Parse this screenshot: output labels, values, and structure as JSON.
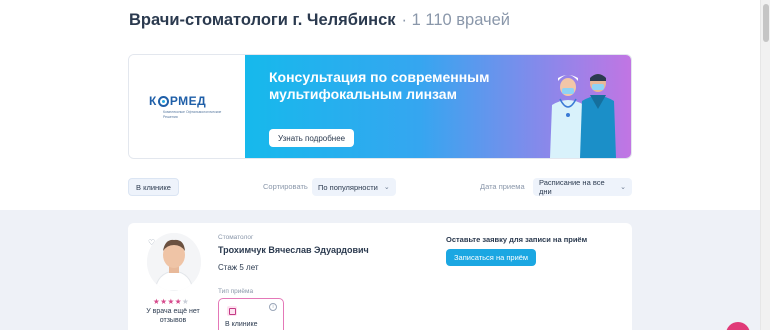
{
  "heading": {
    "title": "Врачи-стоматологи г. Челябинск",
    "count": "· 1 110 врачей"
  },
  "banner": {
    "logo_text": "КОРМЕД",
    "logo_subtitle": "Комплексные Офтальмологические Решения",
    "headline": "Консультация по современным мультифокальным линзам",
    "button_label": "Узнать подробнее"
  },
  "filters": {
    "chip_label": "В клинике",
    "sort_label": "Сортировать",
    "sort_value": "По популярности",
    "date_label": "Дата приема",
    "date_value": "Расписание на все дни"
  },
  "doctor": {
    "specialty": "Стоматолог",
    "name": "Трохимчук Вячеслав Эдуардович",
    "experience": "Стаж 5 лет",
    "rating": 4,
    "rating_max": 5,
    "reviews_text": "У врача ещё нет отзывов",
    "reception_type_label": "Тип приёма",
    "reception_type_value": "В клинике",
    "cta_title": "Оставьте заявку для записи на приём",
    "cta_button": "Записаться на приём"
  },
  "colors": {
    "accent": "#1ba7e2",
    "pink": "#e478b8",
    "star": "#d64a8c"
  }
}
